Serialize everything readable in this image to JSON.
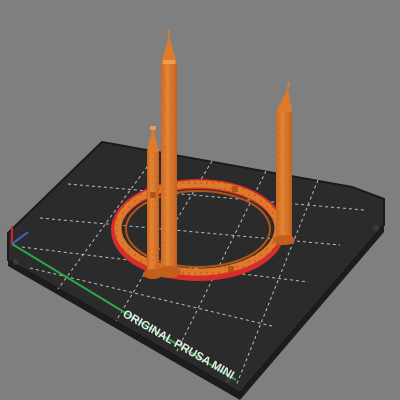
{
  "bed": {
    "label": "ORIGINAL PRUSA MINI",
    "colors": {
      "background": "#7f7f7f",
      "bed_surface": "#2b2b2b",
      "bed_edge": "#1a1a1a",
      "grid": "#d8d8d8",
      "axis_x": "#2aa84a",
      "axis_y": "#3b63d6",
      "axis_z": "#cc2a2a",
      "label": "#e9e9e9"
    }
  },
  "model": {
    "colors": {
      "body": "#e07a2b",
      "shade": "#b25618",
      "highlight": "#f29a4d",
      "first_layer": "#d92d2d"
    }
  }
}
